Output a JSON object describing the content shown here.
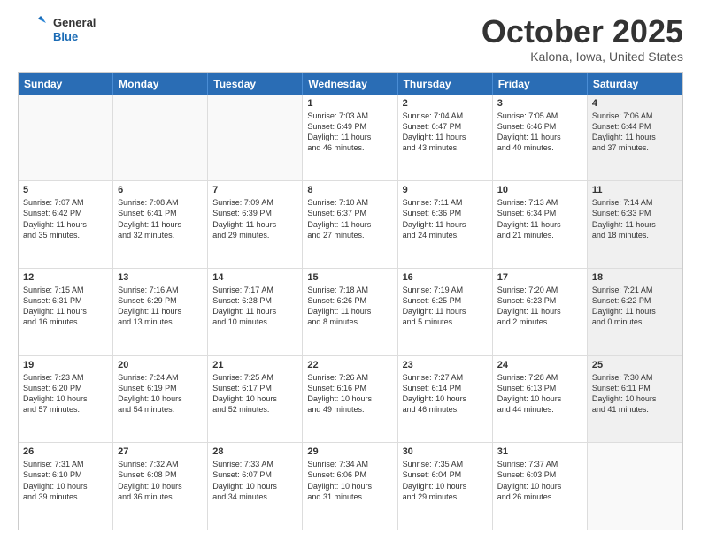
{
  "header": {
    "logo_general": "General",
    "logo_blue": "Blue",
    "month_title": "October 2025",
    "location": "Kalona, Iowa, United States"
  },
  "weekdays": [
    "Sunday",
    "Monday",
    "Tuesday",
    "Wednesday",
    "Thursday",
    "Friday",
    "Saturday"
  ],
  "weeks": [
    [
      {
        "day": "",
        "text": "",
        "empty": true
      },
      {
        "day": "",
        "text": "",
        "empty": true
      },
      {
        "day": "",
        "text": "",
        "empty": true
      },
      {
        "day": "1",
        "text": "Sunrise: 7:03 AM\nSunset: 6:49 PM\nDaylight: 11 hours\nand 46 minutes.",
        "empty": false
      },
      {
        "day": "2",
        "text": "Sunrise: 7:04 AM\nSunset: 6:47 PM\nDaylight: 11 hours\nand 43 minutes.",
        "empty": false
      },
      {
        "day": "3",
        "text": "Sunrise: 7:05 AM\nSunset: 6:46 PM\nDaylight: 11 hours\nand 40 minutes.",
        "empty": false
      },
      {
        "day": "4",
        "text": "Sunrise: 7:06 AM\nSunset: 6:44 PM\nDaylight: 11 hours\nand 37 minutes.",
        "empty": false,
        "shaded": true
      }
    ],
    [
      {
        "day": "5",
        "text": "Sunrise: 7:07 AM\nSunset: 6:42 PM\nDaylight: 11 hours\nand 35 minutes.",
        "empty": false
      },
      {
        "day": "6",
        "text": "Sunrise: 7:08 AM\nSunset: 6:41 PM\nDaylight: 11 hours\nand 32 minutes.",
        "empty": false
      },
      {
        "day": "7",
        "text": "Sunrise: 7:09 AM\nSunset: 6:39 PM\nDaylight: 11 hours\nand 29 minutes.",
        "empty": false
      },
      {
        "day": "8",
        "text": "Sunrise: 7:10 AM\nSunset: 6:37 PM\nDaylight: 11 hours\nand 27 minutes.",
        "empty": false
      },
      {
        "day": "9",
        "text": "Sunrise: 7:11 AM\nSunset: 6:36 PM\nDaylight: 11 hours\nand 24 minutes.",
        "empty": false
      },
      {
        "day": "10",
        "text": "Sunrise: 7:13 AM\nSunset: 6:34 PM\nDaylight: 11 hours\nand 21 minutes.",
        "empty": false
      },
      {
        "day": "11",
        "text": "Sunrise: 7:14 AM\nSunset: 6:33 PM\nDaylight: 11 hours\nand 18 minutes.",
        "empty": false,
        "shaded": true
      }
    ],
    [
      {
        "day": "12",
        "text": "Sunrise: 7:15 AM\nSunset: 6:31 PM\nDaylight: 11 hours\nand 16 minutes.",
        "empty": false
      },
      {
        "day": "13",
        "text": "Sunrise: 7:16 AM\nSunset: 6:29 PM\nDaylight: 11 hours\nand 13 minutes.",
        "empty": false
      },
      {
        "day": "14",
        "text": "Sunrise: 7:17 AM\nSunset: 6:28 PM\nDaylight: 11 hours\nand 10 minutes.",
        "empty": false
      },
      {
        "day": "15",
        "text": "Sunrise: 7:18 AM\nSunset: 6:26 PM\nDaylight: 11 hours\nand 8 minutes.",
        "empty": false
      },
      {
        "day": "16",
        "text": "Sunrise: 7:19 AM\nSunset: 6:25 PM\nDaylight: 11 hours\nand 5 minutes.",
        "empty": false
      },
      {
        "day": "17",
        "text": "Sunrise: 7:20 AM\nSunset: 6:23 PM\nDaylight: 11 hours\nand 2 minutes.",
        "empty": false
      },
      {
        "day": "18",
        "text": "Sunrise: 7:21 AM\nSunset: 6:22 PM\nDaylight: 11 hours\nand 0 minutes.",
        "empty": false,
        "shaded": true
      }
    ],
    [
      {
        "day": "19",
        "text": "Sunrise: 7:23 AM\nSunset: 6:20 PM\nDaylight: 10 hours\nand 57 minutes.",
        "empty": false
      },
      {
        "day": "20",
        "text": "Sunrise: 7:24 AM\nSunset: 6:19 PM\nDaylight: 10 hours\nand 54 minutes.",
        "empty": false
      },
      {
        "day": "21",
        "text": "Sunrise: 7:25 AM\nSunset: 6:17 PM\nDaylight: 10 hours\nand 52 minutes.",
        "empty": false
      },
      {
        "day": "22",
        "text": "Sunrise: 7:26 AM\nSunset: 6:16 PM\nDaylight: 10 hours\nand 49 minutes.",
        "empty": false
      },
      {
        "day": "23",
        "text": "Sunrise: 7:27 AM\nSunset: 6:14 PM\nDaylight: 10 hours\nand 46 minutes.",
        "empty": false
      },
      {
        "day": "24",
        "text": "Sunrise: 7:28 AM\nSunset: 6:13 PM\nDaylight: 10 hours\nand 44 minutes.",
        "empty": false
      },
      {
        "day": "25",
        "text": "Sunrise: 7:30 AM\nSunset: 6:11 PM\nDaylight: 10 hours\nand 41 minutes.",
        "empty": false,
        "shaded": true
      }
    ],
    [
      {
        "day": "26",
        "text": "Sunrise: 7:31 AM\nSunset: 6:10 PM\nDaylight: 10 hours\nand 39 minutes.",
        "empty": false
      },
      {
        "day": "27",
        "text": "Sunrise: 7:32 AM\nSunset: 6:08 PM\nDaylight: 10 hours\nand 36 minutes.",
        "empty": false
      },
      {
        "day": "28",
        "text": "Sunrise: 7:33 AM\nSunset: 6:07 PM\nDaylight: 10 hours\nand 34 minutes.",
        "empty": false
      },
      {
        "day": "29",
        "text": "Sunrise: 7:34 AM\nSunset: 6:06 PM\nDaylight: 10 hours\nand 31 minutes.",
        "empty": false
      },
      {
        "day": "30",
        "text": "Sunrise: 7:35 AM\nSunset: 6:04 PM\nDaylight: 10 hours\nand 29 minutes.",
        "empty": false
      },
      {
        "day": "31",
        "text": "Sunrise: 7:37 AM\nSunset: 6:03 PM\nDaylight: 10 hours\nand 26 minutes.",
        "empty": false
      },
      {
        "day": "",
        "text": "",
        "empty": true,
        "shaded": true
      }
    ]
  ]
}
